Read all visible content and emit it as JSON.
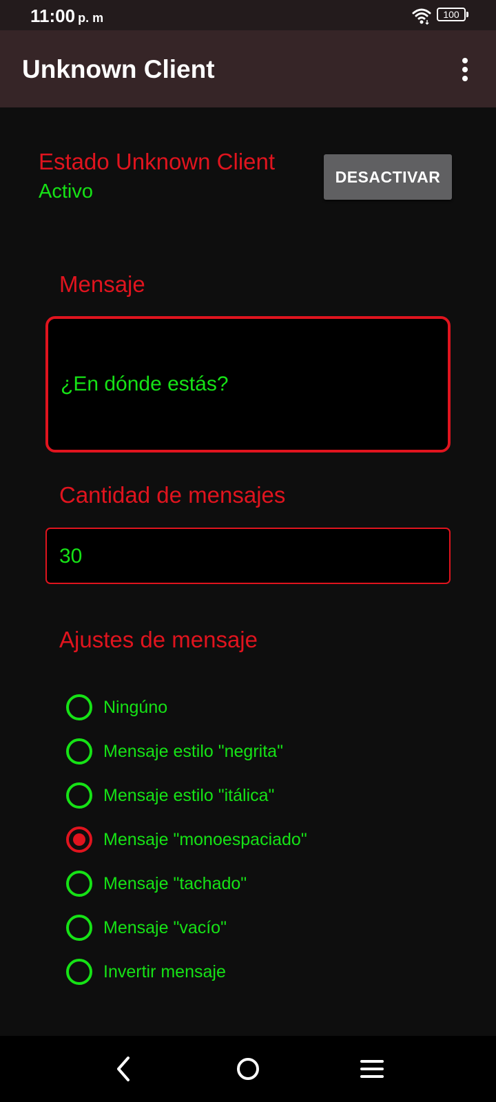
{
  "status_bar": {
    "time": "11:00",
    "ampm": "p. m",
    "battery": "100",
    "icons": [
      "wifi-icon",
      "battery-icon"
    ]
  },
  "app_bar": {
    "title": "Unknown Client",
    "menu_icon": "more-vert-icon"
  },
  "estado": {
    "label": "Estado Unknown Client",
    "value": "Activo",
    "toggle_button": "DESACTIVAR"
  },
  "mensaje": {
    "label": "Mensaje",
    "value": "¿En dónde estás?"
  },
  "cantidad": {
    "label": "Cantidad de mensajes",
    "value": "30"
  },
  "ajustes": {
    "label": "Ajustes de mensaje",
    "options": [
      {
        "label": "Ningúno",
        "selected": false
      },
      {
        "label": "Mensaje estilo \"negrita\"",
        "selected": false
      },
      {
        "label": "Mensaje estilo \"itálica\"",
        "selected": false
      },
      {
        "label": "Mensaje \"monoespaciado\"",
        "selected": true
      },
      {
        "label": "Mensaje \"tachado\"",
        "selected": false
      },
      {
        "label": "Mensaje \"vacío\"",
        "selected": false
      },
      {
        "label": "Invertir mensaje",
        "selected": false
      }
    ]
  },
  "nav_bar": {
    "icons": [
      "back-icon",
      "home-icon",
      "recents-icon"
    ]
  },
  "colors": {
    "accent_red": "#e0141e",
    "accent_green": "#16e216",
    "app_bar_bg": "#362527",
    "background": "#0e0e0e"
  }
}
